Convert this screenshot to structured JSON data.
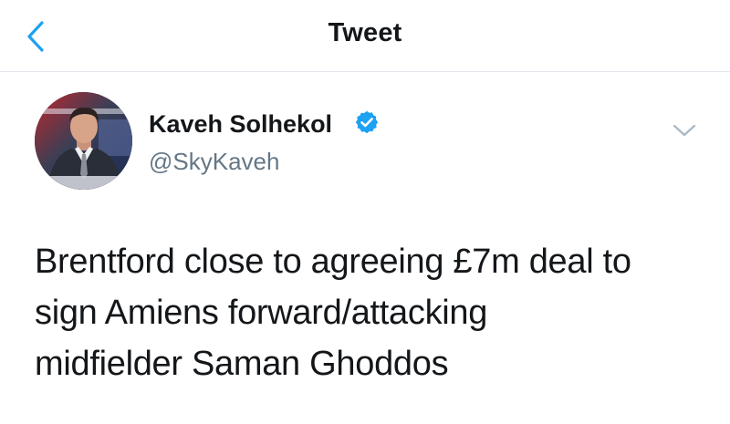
{
  "header": {
    "title": "Tweet",
    "back_icon": "chevron-left-icon"
  },
  "tweet": {
    "author": {
      "name": "Kaveh Solhekol",
      "handle": "@SkyKaveh",
      "verified": true
    },
    "text_lines": [
      "Brentford close to agreeing £7m deal to",
      "sign Amiens forward/attacking",
      "midfielder Saman Ghoddos"
    ],
    "more_icon": "chevron-down-icon"
  },
  "colors": {
    "accent": "#1da1f2",
    "text_primary": "#14171a",
    "text_secondary": "#657786",
    "divider": "#e1e8ed"
  }
}
